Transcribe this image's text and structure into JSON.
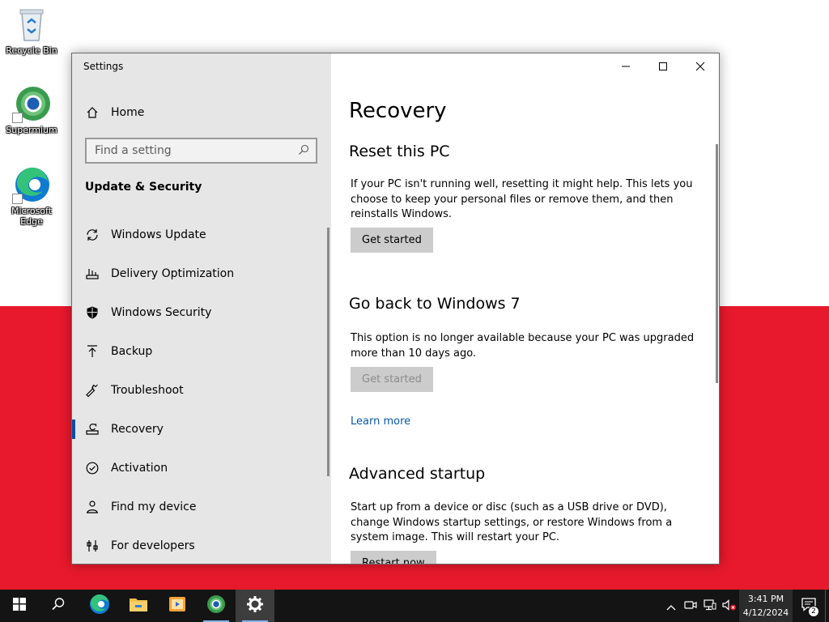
{
  "desktop": {
    "icons": [
      {
        "label": "Recycle Bin",
        "icon": "recycle-bin-icon"
      },
      {
        "label": "Supermium",
        "icon": "supermium-icon"
      },
      {
        "label": "Microsoft Edge",
        "icon": "edge-icon"
      }
    ],
    "colors": {
      "top": "#ffffff",
      "bottom": "#e8192c"
    }
  },
  "window": {
    "title": "Settings",
    "controls": {
      "minimize": "minimize-icon",
      "maximize": "maximize-icon",
      "close": "close-icon"
    }
  },
  "sidebar": {
    "home": "Home",
    "search_placeholder": "Find a setting",
    "section_title": "Update & Security",
    "items": [
      {
        "label": "Windows Update",
        "icon": "sync-icon"
      },
      {
        "label": "Delivery Optimization",
        "icon": "delivery-icon"
      },
      {
        "label": "Windows Security",
        "icon": "shield-icon"
      },
      {
        "label": "Backup",
        "icon": "backup-icon"
      },
      {
        "label": "Troubleshoot",
        "icon": "wrench-icon"
      },
      {
        "label": "Recovery",
        "icon": "recovery-icon",
        "active": true
      },
      {
        "label": "Activation",
        "icon": "check-circle-icon"
      },
      {
        "label": "Find my device",
        "icon": "person-pin-icon"
      },
      {
        "label": "For developers",
        "icon": "developer-icon"
      }
    ]
  },
  "content": {
    "title": "Recovery",
    "reset": {
      "heading": "Reset this PC",
      "text": "If your PC isn't running well, resetting it might help. This lets you choose to keep your personal files or remove them, and then reinstalls Windows.",
      "button": "Get started"
    },
    "goback": {
      "heading": "Go back to Windows 7",
      "text": "This option is no longer available because your PC was upgraded more than 10 days ago.",
      "button": "Get started",
      "link": "Learn more"
    },
    "advanced": {
      "heading": "Advanced startup",
      "text": "Start up from a device or disc (such as a USB drive or DVD), change Windows startup settings, or restore Windows from a system image. This will restart your PC.",
      "button": "Restart now"
    }
  },
  "taskbar": {
    "clock_time": "3:41 PM",
    "clock_date": "4/12/2024",
    "notification_count": "2",
    "apps": [
      "start-icon",
      "search-icon",
      "edge-icon",
      "file-explorer-icon",
      "media-player-icon",
      "supermium-icon",
      "settings-icon"
    ]
  }
}
